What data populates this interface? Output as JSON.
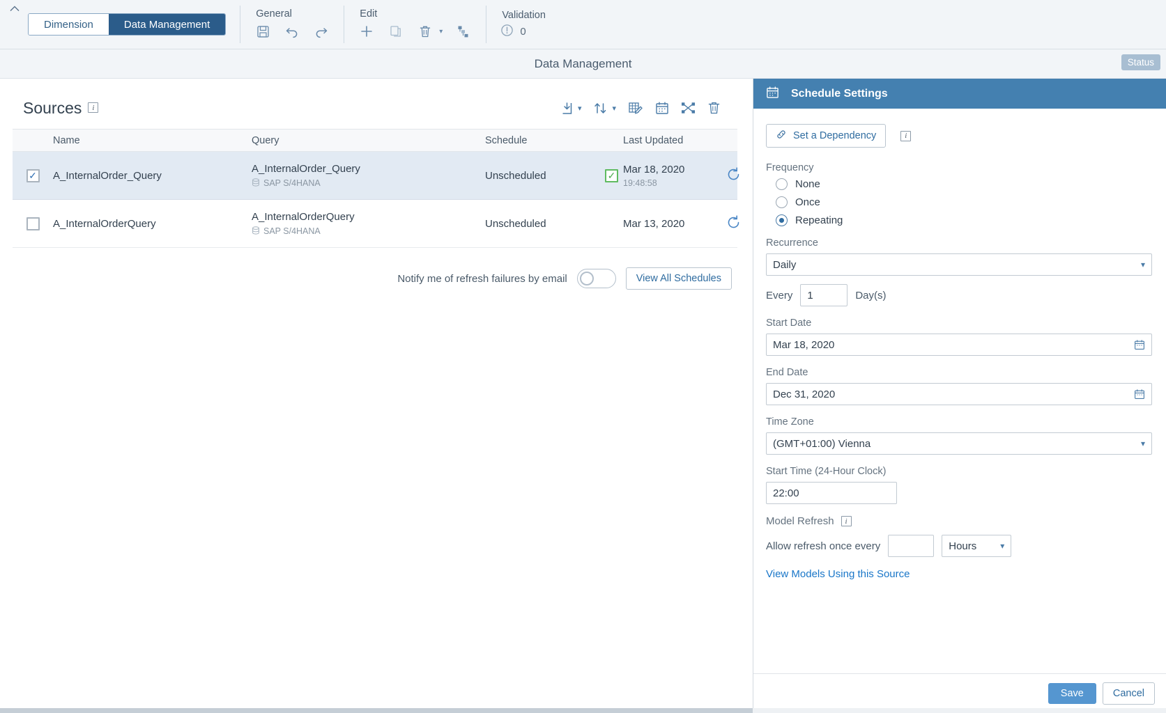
{
  "toolbar": {
    "collapse_icon": "chevron-up-icon",
    "tabs": [
      {
        "label": "Dimension",
        "active": false
      },
      {
        "label": "Data Management",
        "active": true
      }
    ],
    "groups": [
      {
        "title": "General",
        "icons": [
          {
            "name": "save-icon",
            "label": "Save"
          },
          {
            "name": "undo-icon",
            "label": "Undo"
          },
          {
            "name": "redo-icon",
            "label": "Redo"
          }
        ]
      },
      {
        "title": "Edit",
        "icons": [
          {
            "name": "add-icon",
            "label": "Add"
          },
          {
            "name": "copy-icon",
            "label": "Copy"
          },
          {
            "name": "delete-icon",
            "label": "Delete"
          },
          {
            "name": "delete-caret-icon",
            "label": "Delete options"
          },
          {
            "name": "hierarchy-icon",
            "label": "Hierarchy"
          }
        ]
      }
    ],
    "validation": {
      "title": "Validation",
      "icon": "alert-circle-icon",
      "count": "0"
    }
  },
  "titlebar": {
    "title": "Data Management",
    "status_label": "Status"
  },
  "sources": {
    "heading": "Sources",
    "info_icon": "info-icon",
    "actions": [
      {
        "name": "import-icon",
        "label": "Import Data"
      },
      {
        "name": "import-caret-icon",
        "label": "Import options"
      },
      {
        "name": "sort-icon",
        "label": "Sort"
      },
      {
        "name": "sort-caret-icon",
        "label": "Sort options"
      },
      {
        "name": "edit-grid-icon",
        "label": "Edit Query"
      },
      {
        "name": "schedule-calendar-icon",
        "label": "Schedule Settings"
      },
      {
        "name": "data-flow-icon",
        "label": "Data Flow"
      },
      {
        "name": "trash-icon",
        "label": "Delete Source"
      }
    ],
    "columns": [
      "Name",
      "Query",
      "Schedule",
      "Last Updated"
    ],
    "rows": [
      {
        "selected": true,
        "checked": true,
        "name": "A_InternalOrder_Query",
        "query": "A_InternalOrder_Query",
        "system": "SAP S/4HANA",
        "system_icon": "database-icon",
        "schedule": "Unscheduled",
        "status_flag": true,
        "last_updated": "Mar 18, 2020",
        "last_updated_time": "19:48:58",
        "refresh_icon": "refresh-icon"
      },
      {
        "selected": false,
        "checked": false,
        "name": "A_InternalOrderQuery",
        "query": "A_InternalOrderQuery",
        "system": "SAP S/4HANA",
        "system_icon": "database-icon",
        "schedule": "Unscheduled",
        "status_flag": false,
        "last_updated": "Mar 13, 2020",
        "last_updated_time": "",
        "refresh_icon": "refresh-icon"
      }
    ],
    "notify_label": "Notify me of refresh failures by email",
    "notify_on": false,
    "view_all_schedules": "View All Schedules"
  },
  "panel": {
    "icon": "calendar-icon",
    "title": "Schedule Settings",
    "dependency_button": "Set a Dependency",
    "dependency_icon": "link-icon",
    "dependency_info_icon": "info-icon",
    "frequency_label": "Frequency",
    "frequency_options": [
      {
        "label": "None",
        "selected": false
      },
      {
        "label": "Once",
        "selected": false
      },
      {
        "label": "Repeating",
        "selected": true
      }
    ],
    "recurrence_label": "Recurrence",
    "recurrence_value": "Daily",
    "every_label": "Every",
    "every_value": "1",
    "every_unit": "Day(s)",
    "start_date_label": "Start Date",
    "start_date_value": "Mar 18, 2020",
    "end_date_label": "End Date",
    "end_date_value": "Dec 31, 2020",
    "time_zone_label": "Time Zone",
    "time_zone_value": "(GMT+01:00) Vienna",
    "start_time_label": "Start Time (24-Hour Clock)",
    "start_time_value": "22:00",
    "model_refresh_label": "Model Refresh",
    "model_refresh_info_icon": "info-icon",
    "allow_refresh_label": "Allow refresh once every",
    "allow_refresh_value": "",
    "allow_refresh_unit": "Hours",
    "view_models_link": "View Models Using this Source",
    "save_label": "Save",
    "cancel_label": "Cancel"
  },
  "colors": {
    "accent_blue": "#4480b0",
    "tab_active": "#2b5c8a",
    "link": "#1976c8",
    "primary_btn": "#5596d0",
    "row_selected": "#e2eaf3",
    "status_badge": "#a8bed2",
    "green_check": "#4cab4f"
  }
}
